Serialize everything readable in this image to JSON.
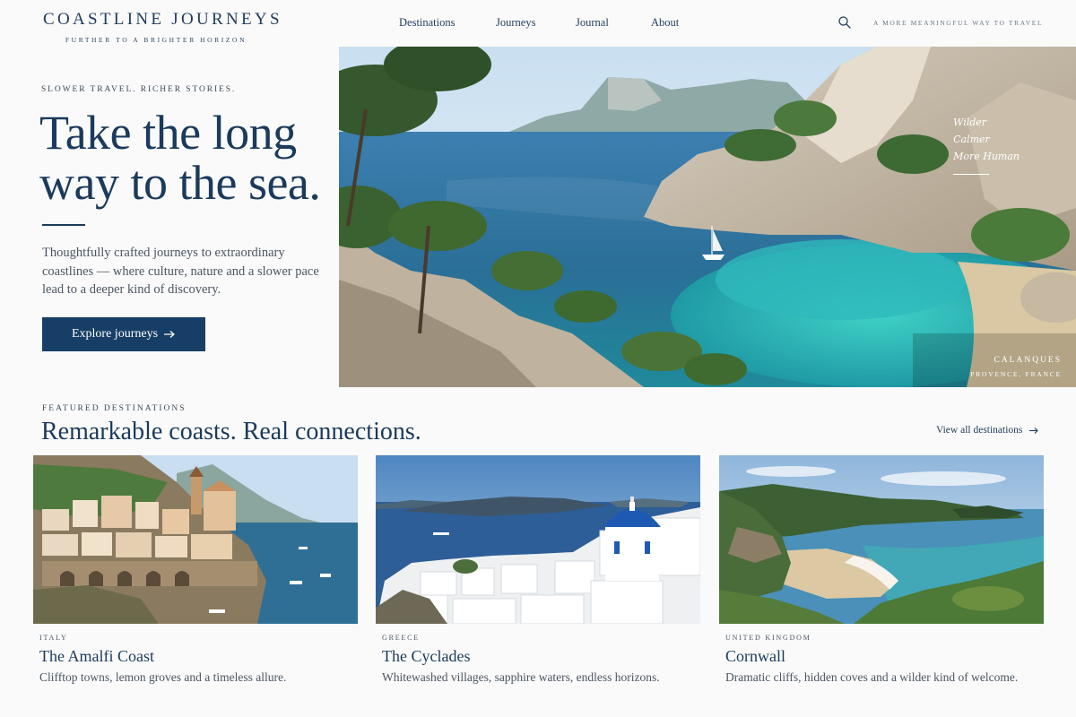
{
  "brand": {
    "name": "COASTLINE JOURNEYS",
    "tagline": "FURTHER TO A BRIGHTER HORIZON"
  },
  "nav": {
    "items": [
      "Destinations",
      "Journeys",
      "Journal",
      "About"
    ],
    "tagline": "A MORE MEANINGFUL WAY TO TRAVEL",
    "search_icon": "search-icon"
  },
  "hero": {
    "eyebrow": "SLOWER TRAVEL. RICHER STORIES.",
    "title_lines": [
      "Take the long",
      "way to the sea."
    ],
    "description": "Thoughtfully crafted journeys to extraordinary coastlines — where culture, nature and a slower pace lead to a deeper kind of discovery.",
    "cta_label": "Explore journeys",
    "cta_icon": "arrow-right-icon",
    "image_words": [
      "Wilder",
      "Calmer",
      "More Human"
    ],
    "caption_place": "CALANQUES",
    "caption_region": "PROVENCE, FRANCE"
  },
  "featured": {
    "eyebrow": "FEATURED DESTINATIONS",
    "title": "Remarkable coasts. Real connections.",
    "view_all_label": "View all destinations",
    "cards": [
      {
        "country": "ITALY",
        "title": "The Amalfi Coast",
        "description": "Clifftop towns, lemon groves and a timeless allure."
      },
      {
        "country": "GREECE",
        "title": "The Cyclades",
        "description": "Whitewashed villages, sapphire waters, endless horizons."
      },
      {
        "country": "UNITED KINGDOM",
        "title": "Cornwall",
        "description": "Dramatic cliffs, hidden coves and a wilder kind of welcome."
      }
    ]
  },
  "colors": {
    "navy": "#1b3a5c",
    "button": "#173e66",
    "background": "#fafafa",
    "sea": "#2a6f97",
    "turquoise": "#2bb3b1"
  }
}
